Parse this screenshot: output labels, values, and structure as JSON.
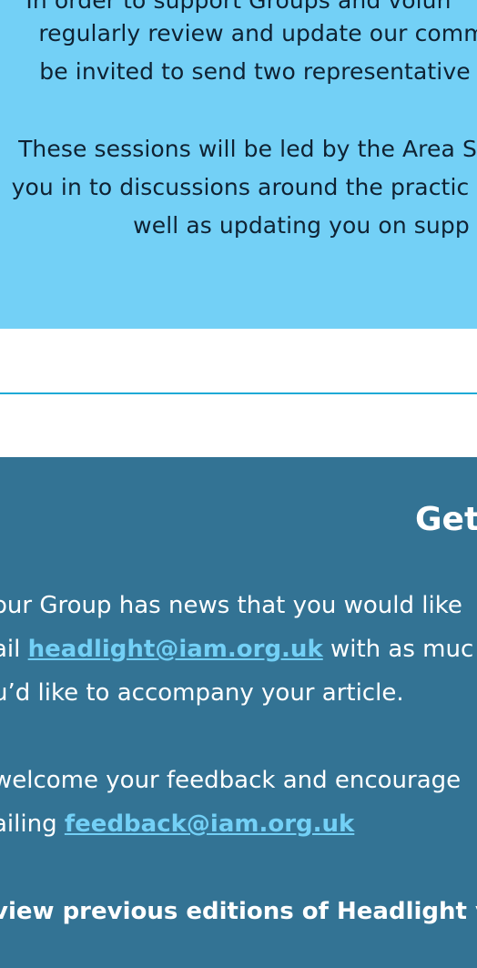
{
  "info_panel": {
    "lines": [
      "In order to support Groups and volun",
      "regularly review and update our commu",
      "be invited to send two representative",
      "These sessions will be led by the Area S",
      "you in to discussions around the practic",
      "well as updating you on supp"
    ],
    "colors": {
      "background": "#73d0f6",
      "text": "#0f2233"
    }
  },
  "contact_panel": {
    "heading": "Get",
    "line1": "our Group has news that you would like",
    "line2_prefix": "ail",
    "email1": "headlight@iam.org.uk",
    "line2_suffix": "with as muc",
    "line3": "u’d like to accompany your article.",
    "line4": "welcome your feedback and encourage",
    "line5_prefix": "ailing",
    "email2": "feedback@iam.org.uk",
    "line6": "view previous editions of Headlight vi",
    "colors": {
      "background": "#337394",
      "text": "#ffffff",
      "link": "#73d0f6",
      "divider": "#1faad6"
    }
  }
}
